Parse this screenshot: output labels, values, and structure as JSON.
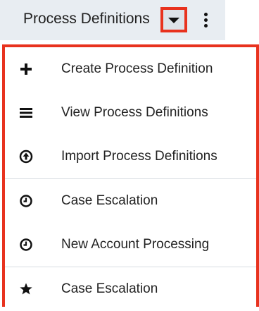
{
  "header": {
    "title": "Process Definitions",
    "dropdown_icon": "caret-down-icon",
    "more_icon": "vertical-ellipsis-icon"
  },
  "colors": {
    "highlight": "#e8321e",
    "header_bg": "#e8edf2",
    "text": "#222222"
  },
  "menu": {
    "groups": [
      {
        "items": [
          {
            "label": "Create Process Definition",
            "icon": "plus-icon"
          },
          {
            "label": "View Process Definitions",
            "icon": "list-icon"
          },
          {
            "label": "Import Process Definitions",
            "icon": "upload-circle-icon"
          }
        ]
      },
      {
        "items": [
          {
            "label": "Case Escalation",
            "icon": "clock-icon"
          },
          {
            "label": "New Account Processing",
            "icon": "clock-icon"
          }
        ]
      },
      {
        "items": [
          {
            "label": "Case Escalation",
            "icon": "star-icon"
          }
        ]
      }
    ]
  }
}
